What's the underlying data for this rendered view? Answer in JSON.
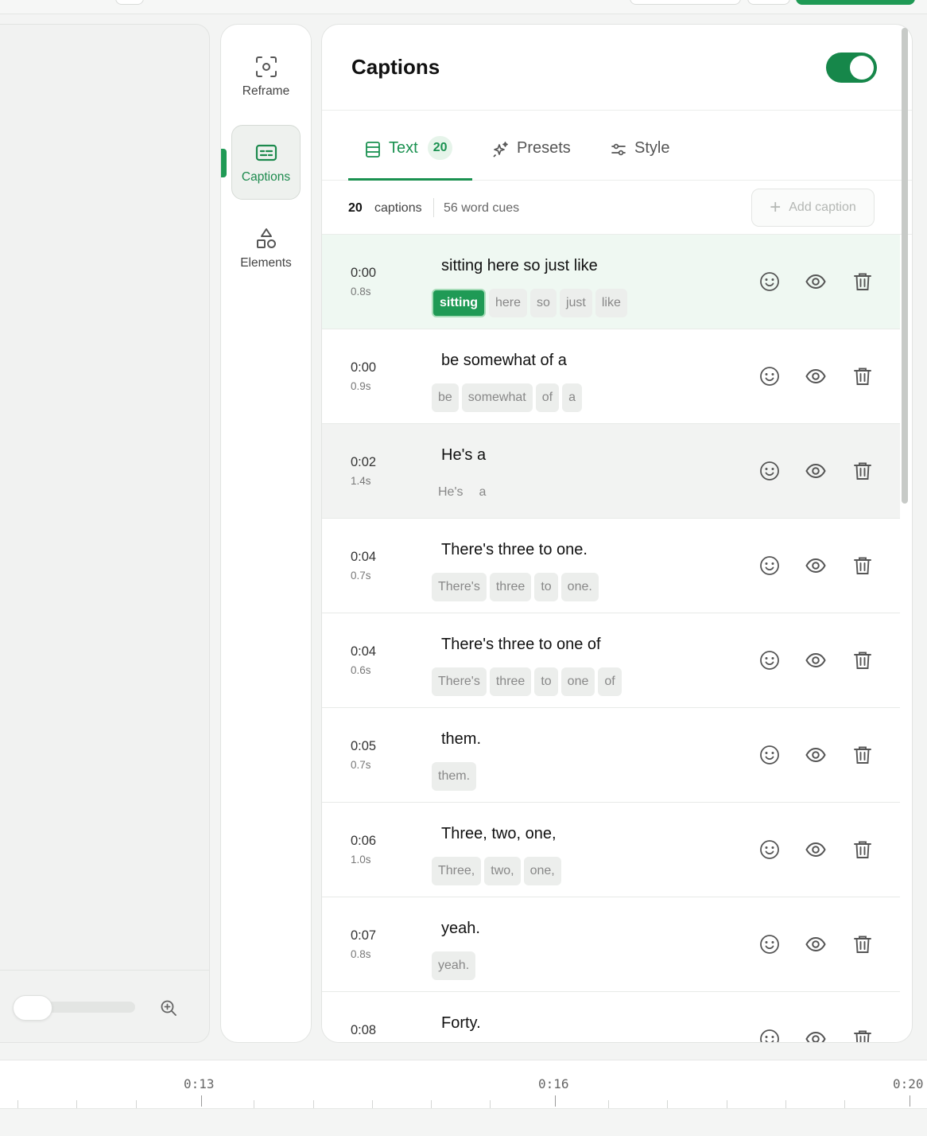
{
  "colors": {
    "accent": "#1f9a55",
    "accent_light": "#e6f4ea",
    "playing_row": "#eff8f2"
  },
  "rail": {
    "items": [
      {
        "label": "Reframe",
        "icon": "reframe-icon"
      },
      {
        "label": "Captions",
        "icon": "captions-icon",
        "active": true
      },
      {
        "label": "Elements",
        "icon": "shapes-icon"
      }
    ]
  },
  "panel": {
    "title": "Captions",
    "enabled": true,
    "tabs": [
      {
        "label": "Text",
        "count": "20",
        "icon": "list-icon",
        "active": true
      },
      {
        "label": "Presets",
        "icon": "sparkle-icon"
      },
      {
        "label": "Style",
        "icon": "sliders-icon"
      }
    ],
    "summary": {
      "count": "20",
      "count_label": "captions",
      "cues": "56 word cues"
    },
    "add_caption": "Add caption",
    "rows": [
      {
        "time": "0:00",
        "dur": "0.8s",
        "text": "sitting here so just like",
        "words": [
          "sitting",
          "here",
          "so",
          "just",
          "like"
        ]
      },
      {
        "time": "0:00",
        "dur": "0.9s",
        "text": "be somewhat of a",
        "words": [
          "be",
          "somewhat",
          "of",
          "a"
        ]
      },
      {
        "time": "0:02",
        "dur": "1.4s",
        "text": "He's a",
        "words": [
          "He's",
          "a"
        ]
      },
      {
        "time": "0:04",
        "dur": "0.7s",
        "text": "There's three to one.",
        "words": [
          "There's",
          "three",
          "to",
          "one."
        ]
      },
      {
        "time": "0:04",
        "dur": "0.6s",
        "text": "There's three to one of",
        "words": [
          "There's",
          "three",
          "to",
          "one",
          "of"
        ]
      },
      {
        "time": "0:05",
        "dur": "0.7s",
        "text": "them.",
        "words": [
          "them."
        ]
      },
      {
        "time": "0:06",
        "dur": "1.0s",
        "text": "Three, two, one,",
        "words": [
          "Three,",
          "two,",
          "one,"
        ]
      },
      {
        "time": "0:07",
        "dur": "0.8s",
        "text": "yeah.",
        "words": [
          "yeah."
        ]
      },
      {
        "time": "0:08",
        "dur": "",
        "text": "Forty.",
        "words": []
      }
    ]
  },
  "timeline": {
    "labels": [
      "0:13",
      "0:16",
      "0:20"
    ]
  }
}
